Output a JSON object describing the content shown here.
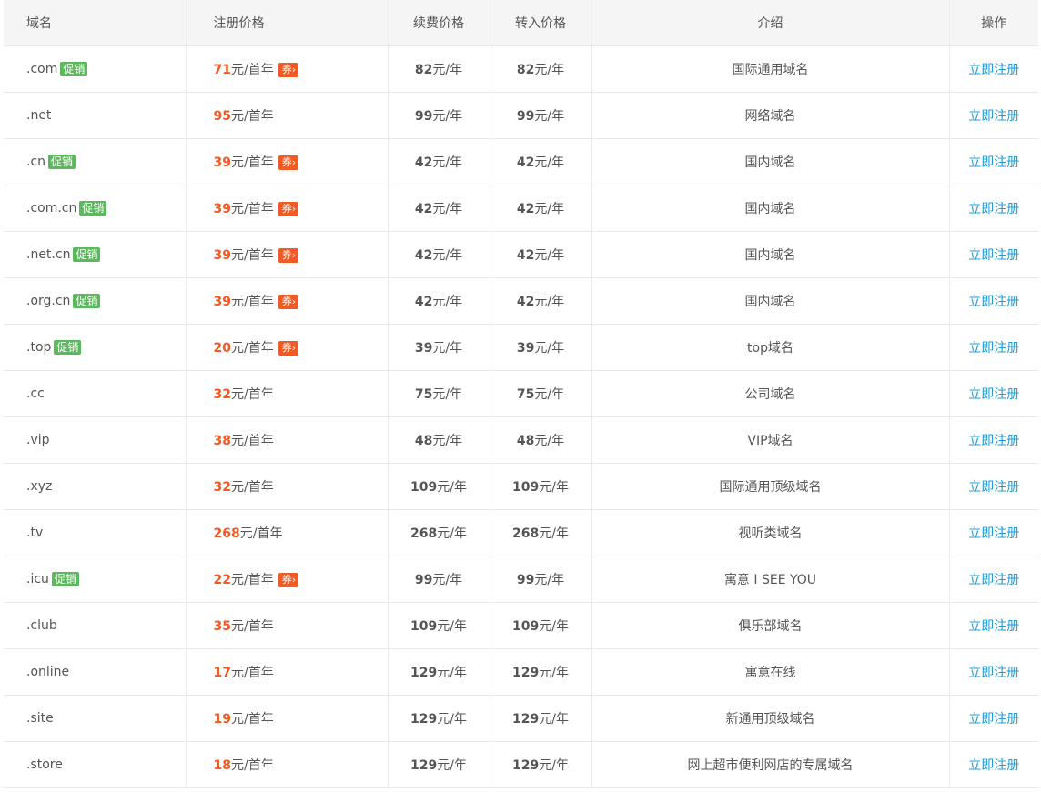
{
  "headers": {
    "domain": "域名",
    "register_price": "注册价格",
    "renew_price": "续费价格",
    "transfer_price": "转入价格",
    "intro": "介绍",
    "action": "操作"
  },
  "labels": {
    "promo": "促销",
    "coupon": "券›",
    "first_year_unit": "元/首年",
    "year_unit": "元/年",
    "register_action": "立即注册"
  },
  "colors": {
    "promo_badge": "#5cb85c",
    "coupon_badge": "#f15a24",
    "register_price": "#f15a24",
    "link": "#1e9bd7",
    "header_bg": "#f5f5f5"
  },
  "rows": [
    {
      "domain": ".com",
      "promo": true,
      "register": "71",
      "coupon": true,
      "renew": "82",
      "transfer": "82",
      "intro": "国际通用域名"
    },
    {
      "domain": ".net",
      "promo": false,
      "register": "95",
      "coupon": false,
      "renew": "99",
      "transfer": "99",
      "intro": "网络域名"
    },
    {
      "domain": ".cn",
      "promo": true,
      "register": "39",
      "coupon": true,
      "renew": "42",
      "transfer": "42",
      "intro": "国内域名"
    },
    {
      "domain": ".com.cn",
      "promo": true,
      "register": "39",
      "coupon": true,
      "renew": "42",
      "transfer": "42",
      "intro": "国内域名"
    },
    {
      "domain": ".net.cn",
      "promo": true,
      "register": "39",
      "coupon": true,
      "renew": "42",
      "transfer": "42",
      "intro": "国内域名"
    },
    {
      "domain": ".org.cn",
      "promo": true,
      "register": "39",
      "coupon": true,
      "renew": "42",
      "transfer": "42",
      "intro": "国内域名"
    },
    {
      "domain": ".top",
      "promo": true,
      "register": "20",
      "coupon": true,
      "renew": "39",
      "transfer": "39",
      "intro": "top域名"
    },
    {
      "domain": ".cc",
      "promo": false,
      "register": "32",
      "coupon": false,
      "renew": "75",
      "transfer": "75",
      "intro": "公司域名"
    },
    {
      "domain": ".vip",
      "promo": false,
      "register": "38",
      "coupon": false,
      "renew": "48",
      "transfer": "48",
      "intro": "VIP域名"
    },
    {
      "domain": ".xyz",
      "promo": false,
      "register": "32",
      "coupon": false,
      "renew": "109",
      "transfer": "109",
      "intro": "国际通用顶级域名"
    },
    {
      "domain": ".tv",
      "promo": false,
      "register": "268",
      "coupon": false,
      "renew": "268",
      "transfer": "268",
      "intro": "视听类域名"
    },
    {
      "domain": ".icu",
      "promo": true,
      "register": "22",
      "coupon": true,
      "renew": "99",
      "transfer": "99",
      "intro": "寓意 I SEE YOU"
    },
    {
      "domain": ".club",
      "promo": false,
      "register": "35",
      "coupon": false,
      "renew": "109",
      "transfer": "109",
      "intro": "俱乐部域名"
    },
    {
      "domain": ".online",
      "promo": false,
      "register": "17",
      "coupon": false,
      "renew": "129",
      "transfer": "129",
      "intro": "寓意在线"
    },
    {
      "domain": ".site",
      "promo": false,
      "register": "19",
      "coupon": false,
      "renew": "129",
      "transfer": "129",
      "intro": "新通用顶级域名"
    },
    {
      "domain": ".store",
      "promo": false,
      "register": "18",
      "coupon": false,
      "renew": "129",
      "transfer": "129",
      "intro": "网上超市便利网店的专属域名"
    }
  ]
}
